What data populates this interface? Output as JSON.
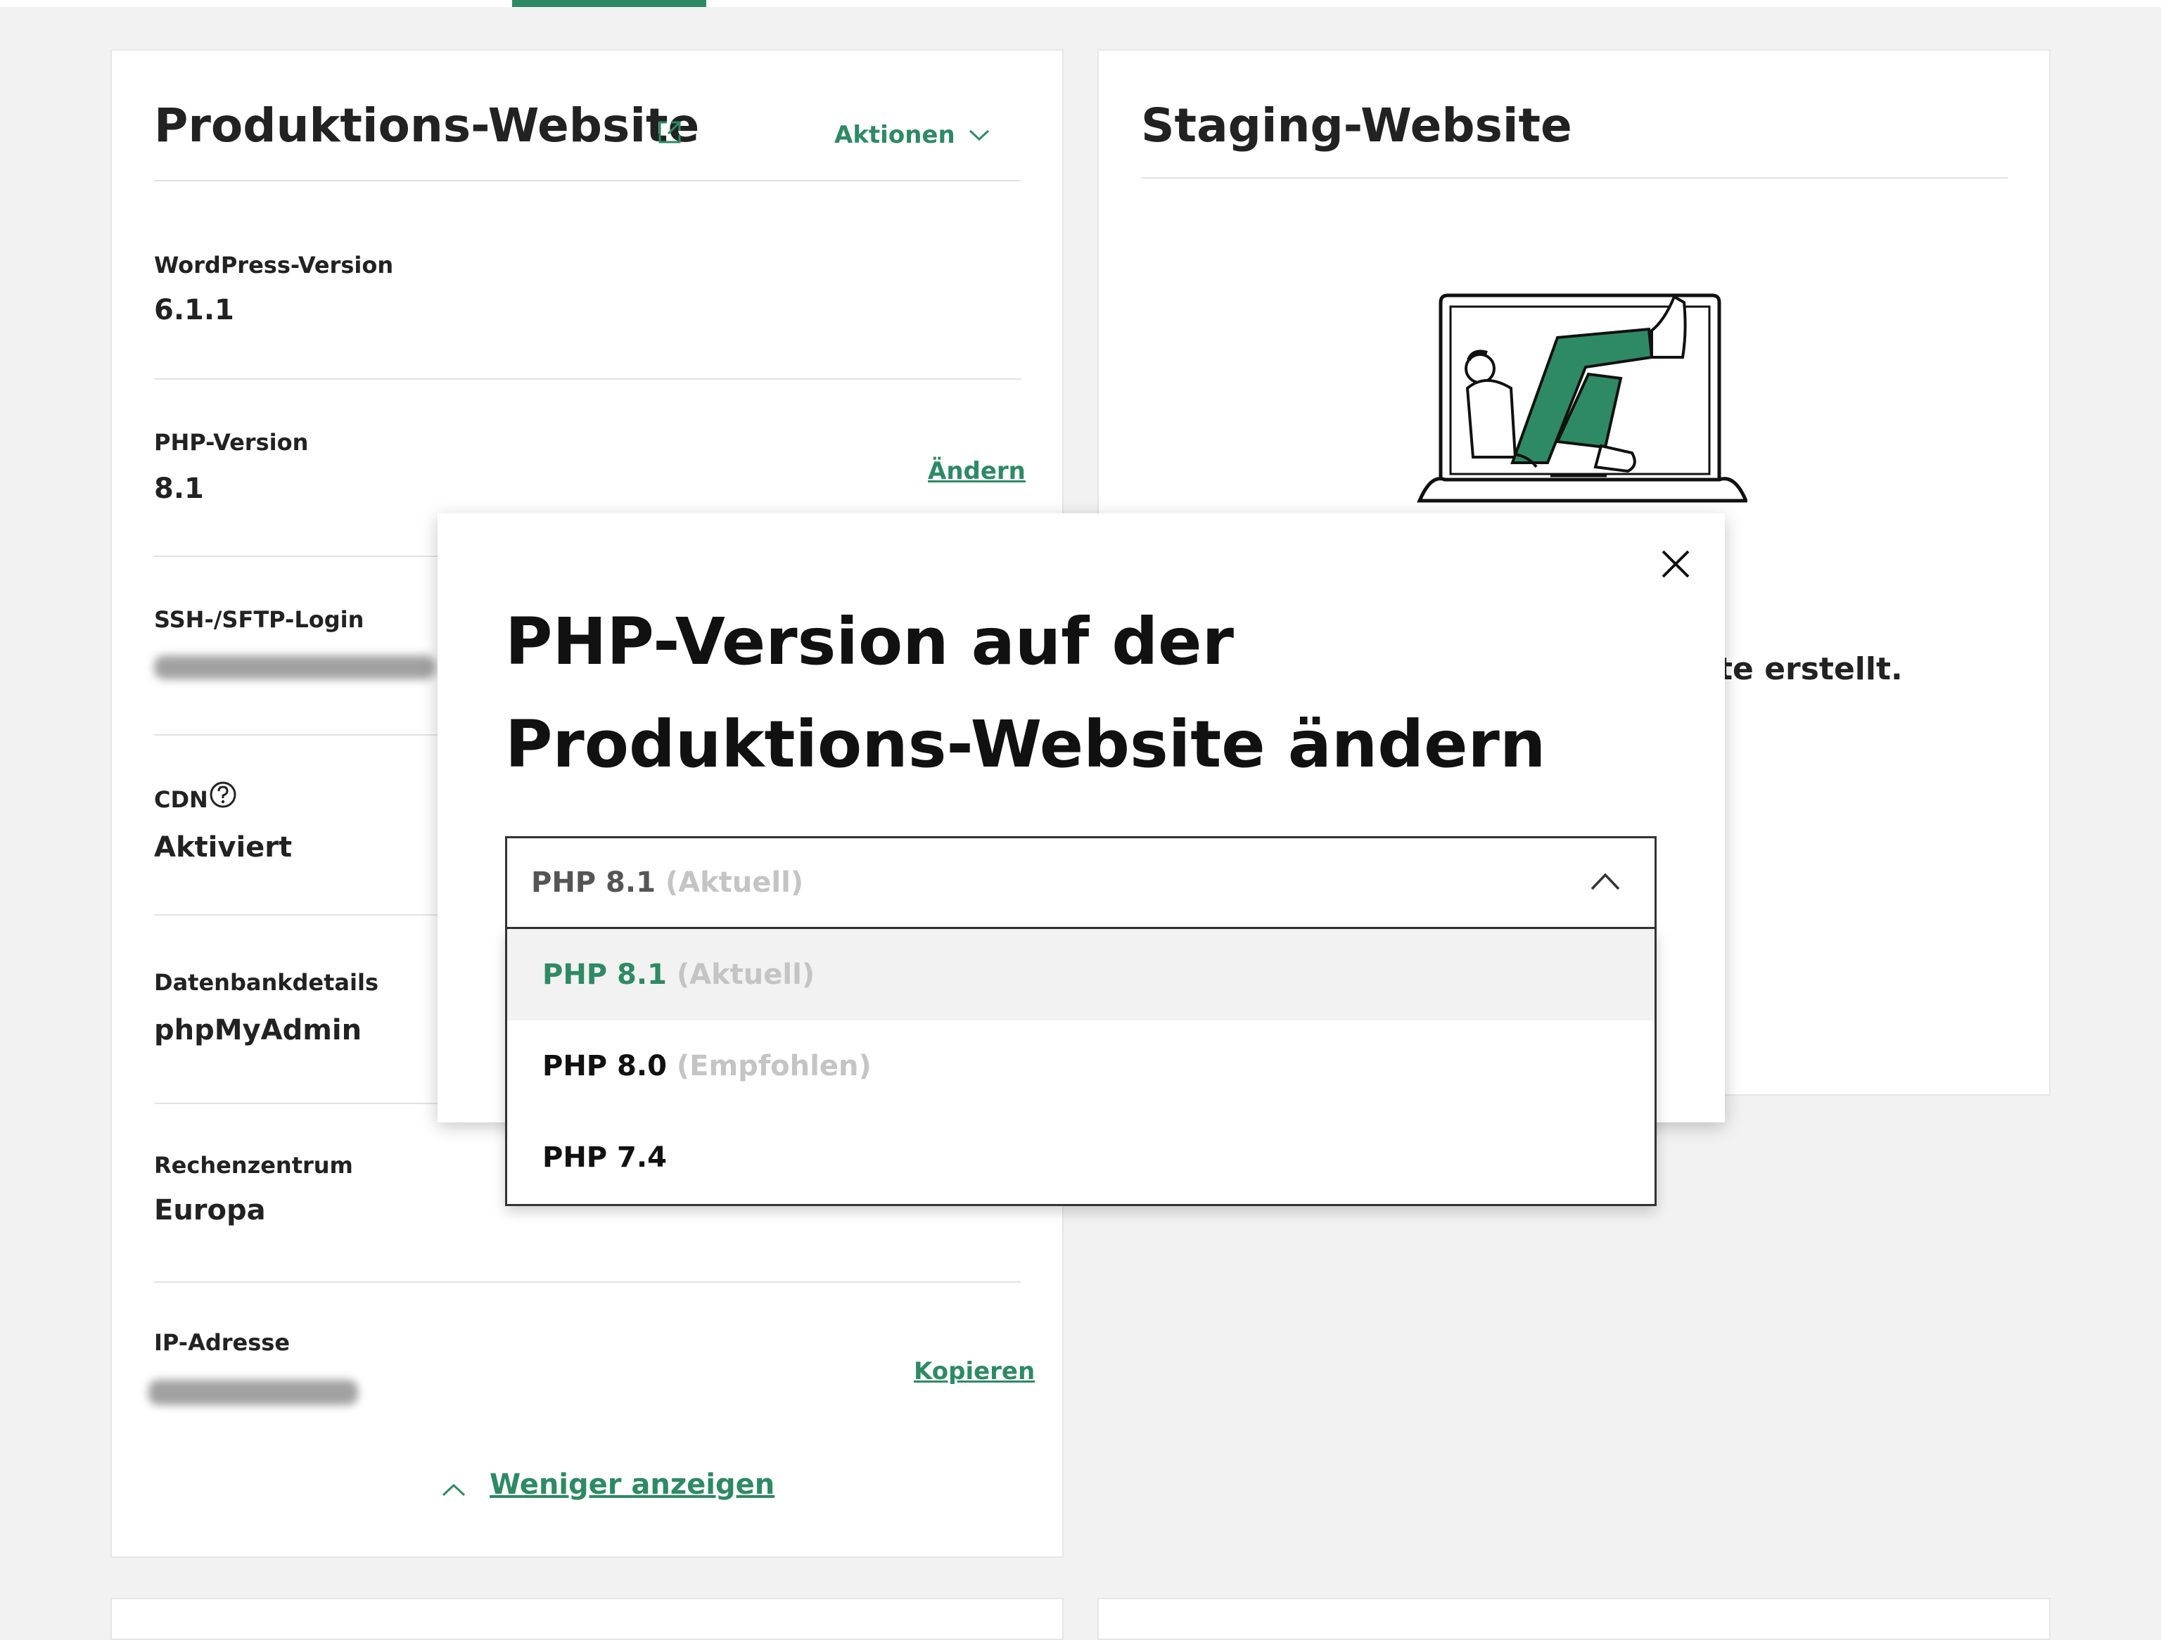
{
  "production": {
    "title": "Produktions-Website",
    "actions_label": "Aktionen",
    "fields": [
      {
        "label": "WordPress-Version",
        "value": "6.1.1"
      },
      {
        "label": "PHP-Version",
        "value": "8.1",
        "action": "Ändern"
      },
      {
        "label": "SSH-/SFTP-Login",
        "value": ""
      },
      {
        "label": "CDN",
        "value": "Aktiviert"
      },
      {
        "label": "Datenbankdetails",
        "value": "phpMyAdmin"
      },
      {
        "label": "Rechenzentrum",
        "value": "Europa"
      },
      {
        "label": "IP-Adresse",
        "value": "",
        "action": "Kopieren"
      }
    ],
    "show_less_label": "Weniger anzeigen"
  },
  "staging": {
    "title": "Staging-Website",
    "visible_text": "te erstellt."
  },
  "modal": {
    "title": "PHP-Version auf der Produktions-Website ändern",
    "select": {
      "current": "PHP 8.1",
      "current_note": "(Aktuell)"
    },
    "options": [
      {
        "label": "PHP 8.1",
        "note": "(Aktuell)",
        "selected": true
      },
      {
        "label": "PHP 8.0",
        "note": "(Empfohlen)",
        "selected": false
      },
      {
        "label": "PHP 7.4",
        "note": "",
        "selected": false
      }
    ]
  },
  "colors": {
    "accent": "#2e8a64",
    "background": "#f2f2f2",
    "text": "#222222"
  },
  "icons": [
    "external-link-icon",
    "chevron-down-icon",
    "help-circle-icon",
    "close-icon",
    "chevron-up-icon",
    "illustration"
  ]
}
